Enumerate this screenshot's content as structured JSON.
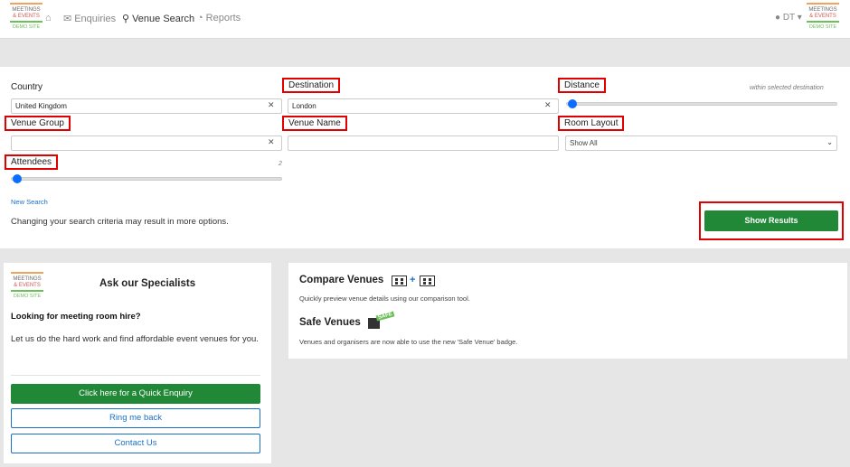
{
  "logo": {
    "line1": "MEETINGS",
    "line2": "& EVENTS",
    "line3": "DEMO SITE"
  },
  "nav": {
    "enquiries": "Enquiries",
    "venue_search": "Venue Search",
    "reports": "Reports",
    "user": "DT ▾"
  },
  "search": {
    "country_label": "Country",
    "country_value": "United Kingdom",
    "destination_label": "Destination",
    "destination_value": "London",
    "distance_label": "Distance",
    "distance_hint": "within selected destination",
    "venue_group_label": "Venue Group",
    "venue_group_value": "",
    "venue_name_label": "Venue Name",
    "venue_name_value": "",
    "room_layout_label": "Room Layout",
    "room_layout_value": "Show All",
    "attendees_label": "Attendees",
    "attendees_value": "2",
    "distance_level": 0.0,
    "attendees_level": 0.0,
    "new_search": "New Search",
    "criteria_note": "Changing your search criteria may result in more options.",
    "show_results": "Show Results"
  },
  "specialists": {
    "title": "Ask our Specialists",
    "subtitle": "Looking for meeting room hire?",
    "body": "Let us do the hard work and find affordable event venues for you.",
    "quick_enquiry": "Click here for a Quick Enquiry",
    "ring_me_back": "Ring me back",
    "contact_us": "Contact Us"
  },
  "compare": {
    "title": "Compare Venues",
    "desc": "Quickly preview venue details using our comparison tool.",
    "safe_title": "Safe Venues",
    "safe_badge": "SAFE",
    "safe_desc": "Venues and organisers are now able to use the new 'Safe Venue' badge."
  },
  "colors": {
    "primary_green": "#218838",
    "link_blue": "#1a6fc9",
    "highlight_red": "#e00000",
    "slider_blue": "#0d6efd"
  }
}
